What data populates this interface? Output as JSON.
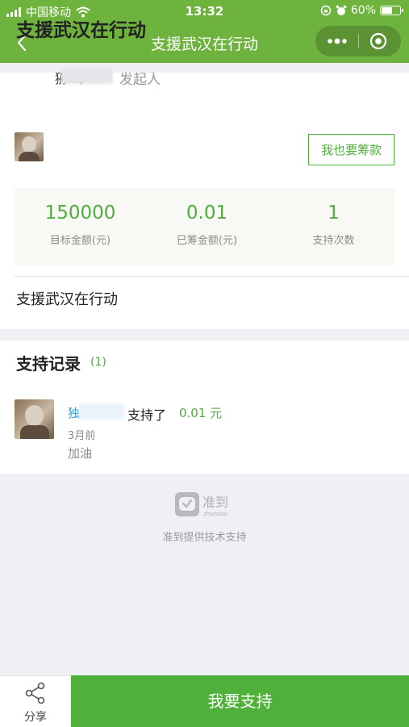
{
  "status_bar": {
    "carrier": "中国移动",
    "time": "13:32",
    "battery_percent": "60%",
    "battery_level": 0.6
  },
  "nav": {
    "title": "支援武汉在行动"
  },
  "project": {
    "title": "支援武汉在行动",
    "initiator_name_visible": "狲            瑋",
    "initiator_role": "发起人",
    "raise_button": "我也要筹款",
    "description": "支援武汉在行动"
  },
  "stats": [
    {
      "value": "150000",
      "label": "目标金额(元)"
    },
    {
      "value": "0.01",
      "label": "已筹金额(元)"
    },
    {
      "value": "1",
      "label": "支持次数"
    }
  ],
  "records": {
    "title": "支持记录",
    "count": "(1)",
    "items": [
      {
        "name": "独",
        "action": "支持了",
        "amount": "0.01 元",
        "time": "3月前",
        "message": "加油"
      }
    ]
  },
  "footer": {
    "logo_text": "准到",
    "logo_subtext": "zhundao",
    "tech_support": "准到提供技术支持"
  },
  "bottom_bar": {
    "share_label": "分享",
    "support_button": "我要支持"
  },
  "colors": {
    "brand_green": "#6fb33f",
    "accent_green": "#4fae3c",
    "link_blue": "#2fa3dc"
  }
}
